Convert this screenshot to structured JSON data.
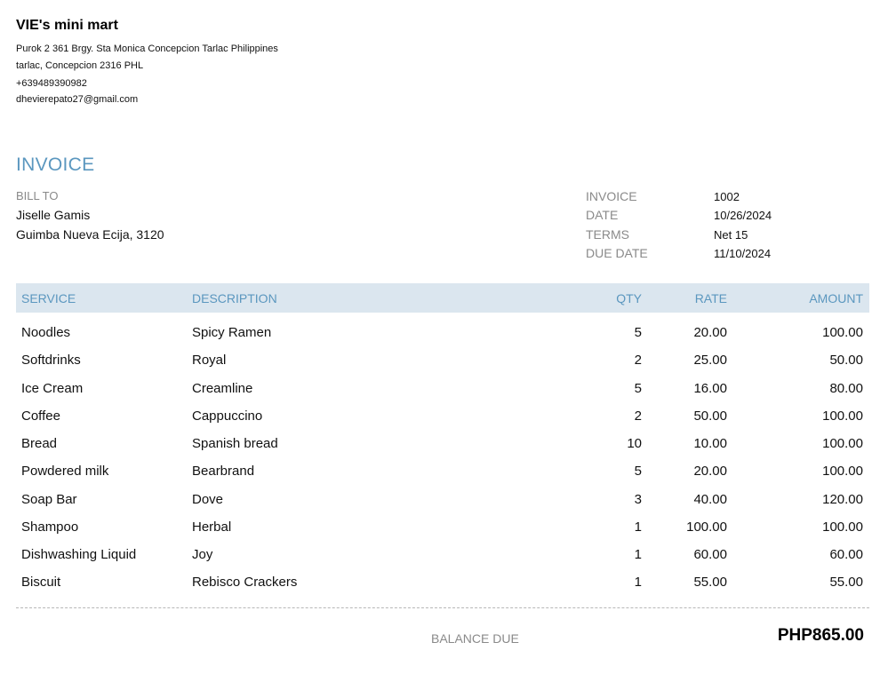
{
  "company": {
    "name": "VIE's mini mart",
    "address_line1": "Purok 2 361 Brgy. Sta Monica Concepcion Tarlac Philippines",
    "address_line2": "tarlac, Concepcion  2316 PHL",
    "phone": "+639489390982",
    "email": "dhevierepato27@gmail.com"
  },
  "document": {
    "title": "INVOICE"
  },
  "bill_to": {
    "label": "BILL TO",
    "name": "Jiselle Gamis",
    "address": "Guimba Nueva Ecija, 3120"
  },
  "meta": [
    {
      "label": "INVOICE",
      "value": "1002"
    },
    {
      "label": "DATE",
      "value": "10/26/2024"
    },
    {
      "label": "TERMS",
      "value": "Net 15"
    },
    {
      "label": "DUE DATE",
      "value": "11/10/2024"
    }
  ],
  "table": {
    "headers": {
      "service": "SERVICE",
      "description": "DESCRIPTION",
      "qty": "QTY",
      "rate": "RATE",
      "amount": "AMOUNT"
    },
    "rows": [
      {
        "service": "Noodles",
        "description": "Spicy Ramen",
        "qty": "5",
        "rate": "20.00",
        "amount": "100.00"
      },
      {
        "service": "Softdrinks",
        "description": "Royal",
        "qty": "2",
        "rate": "25.00",
        "amount": "50.00"
      },
      {
        "service": "Ice Cream",
        "description": "Creamline",
        "qty": "5",
        "rate": "16.00",
        "amount": "80.00"
      },
      {
        "service": "Coffee",
        "description": "Cappuccino",
        "qty": "2",
        "rate": "50.00",
        "amount": "100.00"
      },
      {
        "service": "Bread",
        "description": "Spanish bread",
        "qty": "10",
        "rate": "10.00",
        "amount": "100.00"
      },
      {
        "service": "Powdered milk",
        "description": "Bearbrand",
        "qty": "5",
        "rate": "20.00",
        "amount": "100.00"
      },
      {
        "service": "Soap Bar",
        "description": "Dove",
        "qty": "3",
        "rate": "40.00",
        "amount": "120.00"
      },
      {
        "service": "Shampoo",
        "description": "Herbal",
        "qty": "1",
        "rate": "100.00",
        "amount": "100.00"
      },
      {
        "service": "Dishwashing Liquid",
        "description": "Joy",
        "qty": "1",
        "rate": "60.00",
        "amount": "60.00"
      },
      {
        "service": "Biscuit",
        "description": "Rebisco Crackers",
        "qty": "1",
        "rate": "55.00",
        "amount": "55.00"
      }
    ]
  },
  "balance": {
    "label": "BALANCE DUE",
    "value": "PHP865.00"
  },
  "colors": {
    "accent": "#5b97bf",
    "header_bg": "#dbe6ef",
    "muted_label": "#8a8a8a"
  }
}
